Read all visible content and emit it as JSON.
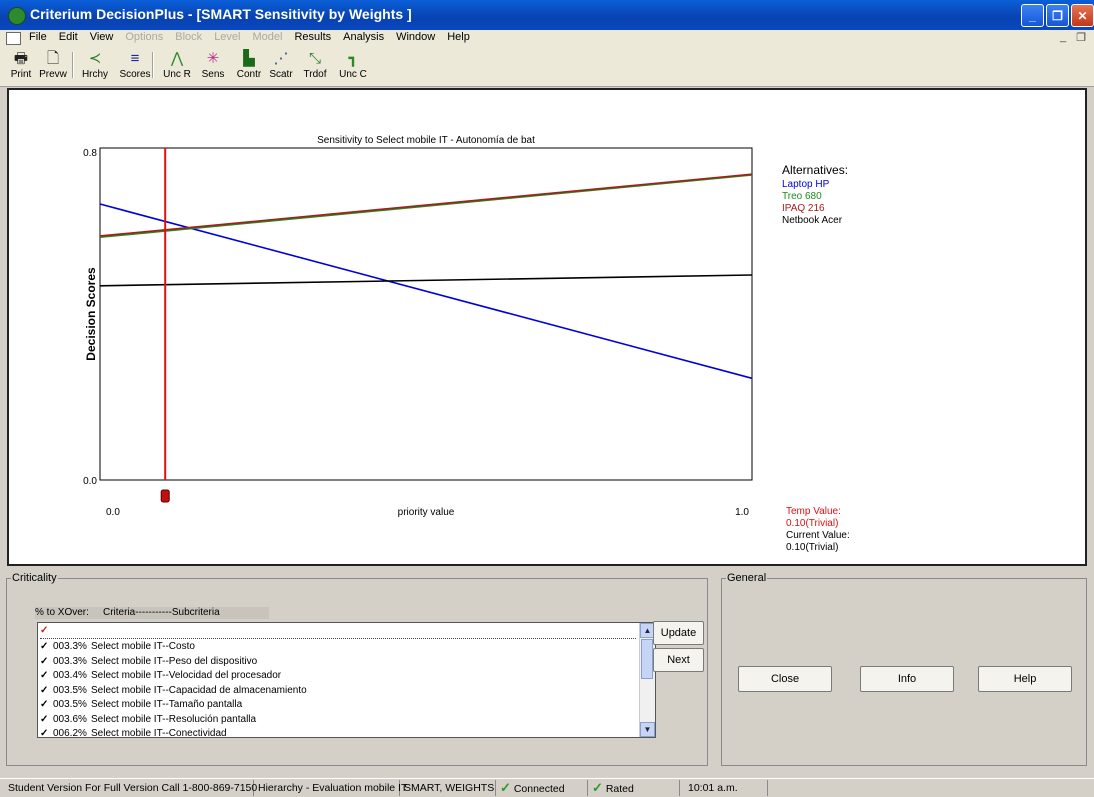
{
  "window": {
    "title": "Criterium DecisionPlus - [SMART Sensitivity by Weights ]",
    "controls": [
      "_",
      "❐",
      "✕"
    ],
    "mdi_controls": [
      "_",
      "❐"
    ]
  },
  "menu": {
    "items": [
      {
        "label": "File",
        "enabled": true
      },
      {
        "label": "Edit",
        "enabled": true
      },
      {
        "label": "View",
        "enabled": true
      },
      {
        "label": "Options",
        "enabled": false
      },
      {
        "label": "Block",
        "enabled": false
      },
      {
        "label": "Level",
        "enabled": false
      },
      {
        "label": "Model",
        "enabled": false
      },
      {
        "label": "Results",
        "enabled": true
      },
      {
        "label": "Analysis",
        "enabled": true
      },
      {
        "label": "Window",
        "enabled": true
      },
      {
        "label": "Help",
        "enabled": true
      }
    ]
  },
  "toolbar": {
    "buttons": [
      {
        "label": "Print",
        "icon": "printer-icon",
        "glyph": "🖶",
        "color": "#222222"
      },
      {
        "label": "Prevw",
        "icon": "preview-icon",
        "glyph": "🗋",
        "color": "#222222"
      },
      {
        "label": "Hrchy",
        "icon": "hierarchy-icon",
        "glyph": "≺",
        "color": "#2a7a2a"
      },
      {
        "label": "Scores",
        "icon": "scores-icon",
        "glyph": "≡",
        "color": "#1a2a9a"
      },
      {
        "label": "Unc R",
        "icon": "uncertainty-icon",
        "glyph": "⋀",
        "color": "#2a8a2a"
      },
      {
        "label": "Sens",
        "icon": "sensitivity-icon",
        "glyph": "✳",
        "color": "#c02a8a"
      },
      {
        "label": "Contr",
        "icon": "contribution-icon",
        "glyph": "▙",
        "color": "#1a6a1a"
      },
      {
        "label": "Scatr",
        "icon": "scatter-icon",
        "glyph": "⋰",
        "color": "#2a4a9a"
      },
      {
        "label": "Trdof",
        "icon": "tradeoff-icon",
        "glyph": "⤡",
        "color": "#2a7a2a"
      },
      {
        "label": "Unc C",
        "icon": "uncertainty-c-icon",
        "glyph": "┓",
        "color": "#2a8a2a"
      }
    ]
  },
  "chart_data": {
    "type": "line",
    "title": "Sensitivity to Select mobile IT - Autonomía de bat",
    "xlabel": "priority value",
    "ylabel": "Decision Scores",
    "xlim": [
      0,
      1
    ],
    "ylim": [
      0,
      0.8
    ],
    "x_ticks": [
      "0.0",
      "1.0"
    ],
    "y_ticks": [
      "0.0",
      "0.8"
    ],
    "current_priority": 0.1,
    "series": [
      {
        "name": "Laptop HP",
        "color": "#0000dd",
        "x": [
          0,
          1
        ],
        "y": [
          0.665,
          0.245
        ]
      },
      {
        "name": "Treo 680",
        "color": "#1d8a1d",
        "x": [
          0,
          1
        ],
        "y": [
          0.585,
          0.735
        ]
      },
      {
        "name": "IPAQ 216",
        "color": "#a81c1c",
        "x": [
          0,
          1
        ],
        "y": [
          0.588,
          0.737
        ]
      },
      {
        "name": "Netbook Acer",
        "color": "#000000",
        "x": [
          0,
          1
        ],
        "y": [
          0.468,
          0.494
        ]
      }
    ],
    "legend_title": "Alternatives:",
    "legend_position": "top-right"
  },
  "values_panel": {
    "temp_label": "Temp Value:",
    "temp_value": "0.10(Trivial)",
    "current_label": "Current Value:",
    "current_value": "0.10(Trivial)"
  },
  "criticality": {
    "title": "Criticality",
    "col_pct": "% to XOver:",
    "col_name": "Criteria-----------Subcriteria",
    "rows": [
      {
        "pct": "003.3%",
        "name": "Select mobile IT--Costo"
      },
      {
        "pct": "003.3%",
        "name": "Select mobile IT--Peso del dispositivo"
      },
      {
        "pct": "003.4%",
        "name": "Select mobile IT--Velocidad del procesador"
      },
      {
        "pct": "003.5%",
        "name": "Select mobile IT--Capacidad de almacenamiento"
      },
      {
        "pct": "003.5%",
        "name": "Select mobile IT--Tamaño pantalla"
      },
      {
        "pct": "003.6%",
        "name": "Select mobile IT--Resolución pantalla"
      },
      {
        "pct": "006.2%",
        "name": "Select mobile IT--Conectividad"
      }
    ],
    "update_label": "Update",
    "next_label": "Next"
  },
  "general": {
    "title": "General",
    "close_label": "Close",
    "info_label": "Info",
    "help_label": "Help"
  },
  "status": {
    "version": "Student Version For Full Version Call 1-800-869-7150",
    "hierarchy": "Hierarchy - Evaluation mobile IT",
    "mode": "SMART, WEIGHTS",
    "connected": "Connected",
    "rated": "Rated",
    "time": "10:01 a.m."
  }
}
